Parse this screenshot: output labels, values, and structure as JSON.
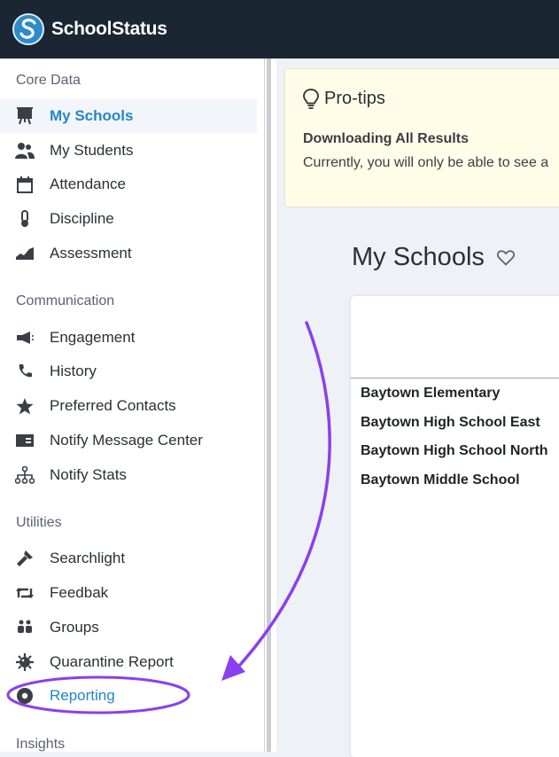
{
  "header": {
    "brand": "SchoolStatus",
    "logo_letter": "S",
    "logo_icon": "schoolstatus-logo-icon",
    "background_color": "#1b2633"
  },
  "sidebar": {
    "sections": [
      {
        "title": "Core Data",
        "items": [
          {
            "label": "My Schools",
            "icon": "easel-icon",
            "active": true
          },
          {
            "label": "My Students",
            "icon": "people-icon"
          },
          {
            "label": "Attendance",
            "icon": "calendar-icon"
          },
          {
            "label": "Discipline",
            "icon": "thermometer-icon"
          },
          {
            "label": "Assessment",
            "icon": "area-chart-icon"
          }
        ]
      },
      {
        "title": "Communication",
        "items": [
          {
            "label": "Engagement",
            "icon": "megaphone-icon"
          },
          {
            "label": "History",
            "icon": "phone-icon"
          },
          {
            "label": "Preferred Contacts",
            "icon": "star-icon"
          },
          {
            "label": "Notify Message Center",
            "icon": "id-card-icon"
          },
          {
            "label": "Notify Stats",
            "icon": "sitemap-icon"
          }
        ]
      },
      {
        "title": "Utilities",
        "items": [
          {
            "label": "Searchlight",
            "icon": "flashlight-icon"
          },
          {
            "label": "Feedbak",
            "icon": "retweet-icon"
          },
          {
            "label": "Groups",
            "icon": "users-icon"
          },
          {
            "label": "Quarantine Report",
            "icon": "virus-icon"
          },
          {
            "label": "Reporting",
            "icon": "record-icon",
            "highlighted": true
          }
        ]
      },
      {
        "title": "Insights",
        "items": []
      }
    ]
  },
  "protips": {
    "icon": "lightbulb-icon",
    "title": "Pro-tips",
    "heading": "Downloading All Results",
    "text": "Currently, you will only be able to see a"
  },
  "main": {
    "page_title": "My Schools",
    "favorite_icon": "heart-outline-icon",
    "schools": [
      "Baytown Elementary",
      "Baytown High School East",
      "Baytown High School North",
      "Baytown Middle School"
    ]
  },
  "annotation": {
    "color": "#8a3ff0",
    "shapes": [
      "curved-arrow",
      "ellipse-highlight"
    ]
  },
  "colors": {
    "accent": "#2486c7",
    "protips_bg": "#fffde8"
  }
}
